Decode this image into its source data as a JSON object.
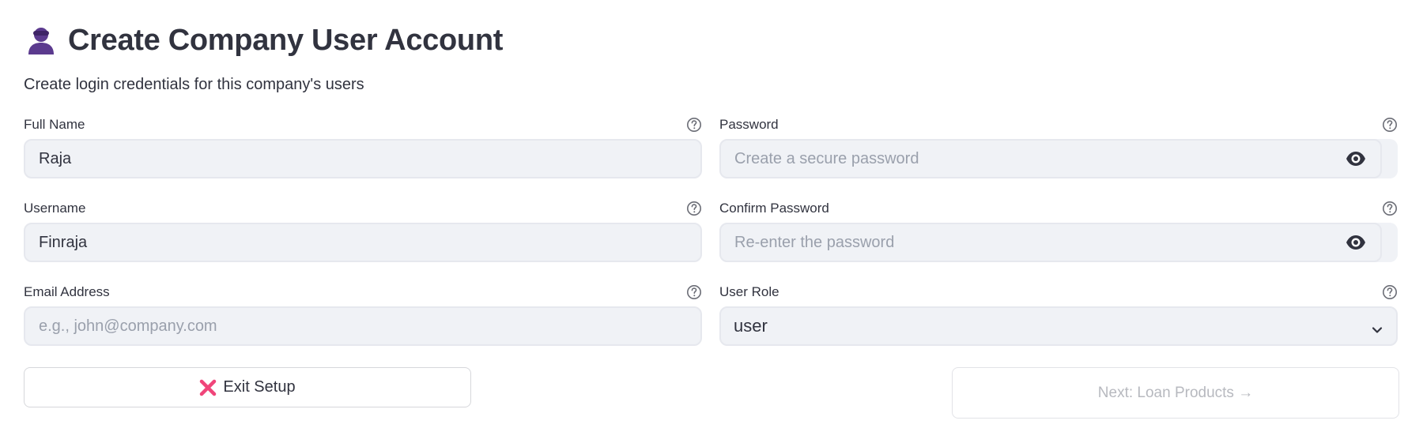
{
  "header": {
    "title": "Create Company User Account",
    "icon": "user-icon"
  },
  "subtitle": "Create login credentials for this company's users",
  "fields": {
    "full_name": {
      "label": "Full Name",
      "value": "Raja",
      "help_icon": "question-circle-icon"
    },
    "username": {
      "label": "Username",
      "value": "Finraja",
      "help_icon": "question-circle-icon"
    },
    "email": {
      "label": "Email Address",
      "value": "",
      "placeholder": "e.g., john@company.com",
      "help_icon": "question-circle-icon"
    },
    "password": {
      "label": "Password",
      "value": "",
      "placeholder": "Create a secure password",
      "toggle_icon": "eye-icon",
      "help_icon": "question-circle-icon"
    },
    "confirm_password": {
      "label": "Confirm Password",
      "value": "",
      "placeholder": "Re-enter the password",
      "toggle_icon": "eye-icon",
      "help_icon": "question-circle-icon"
    },
    "user_role": {
      "label": "User Role",
      "selected": "user",
      "help_icon": "question-circle-icon"
    }
  },
  "buttons": {
    "exit_label": "Exit Setup",
    "exit_icon": "x-mark-icon",
    "next_label": "Next: Loan Products →",
    "next_disabled": true
  },
  "colors": {
    "text": "#31333f",
    "input_bg": "#f0f2f6",
    "placeholder": "#9aa0ac",
    "icon_purple": "#5b3a8e",
    "exit_x": "#f0457a",
    "disabled_text": "#b7b9bf"
  }
}
